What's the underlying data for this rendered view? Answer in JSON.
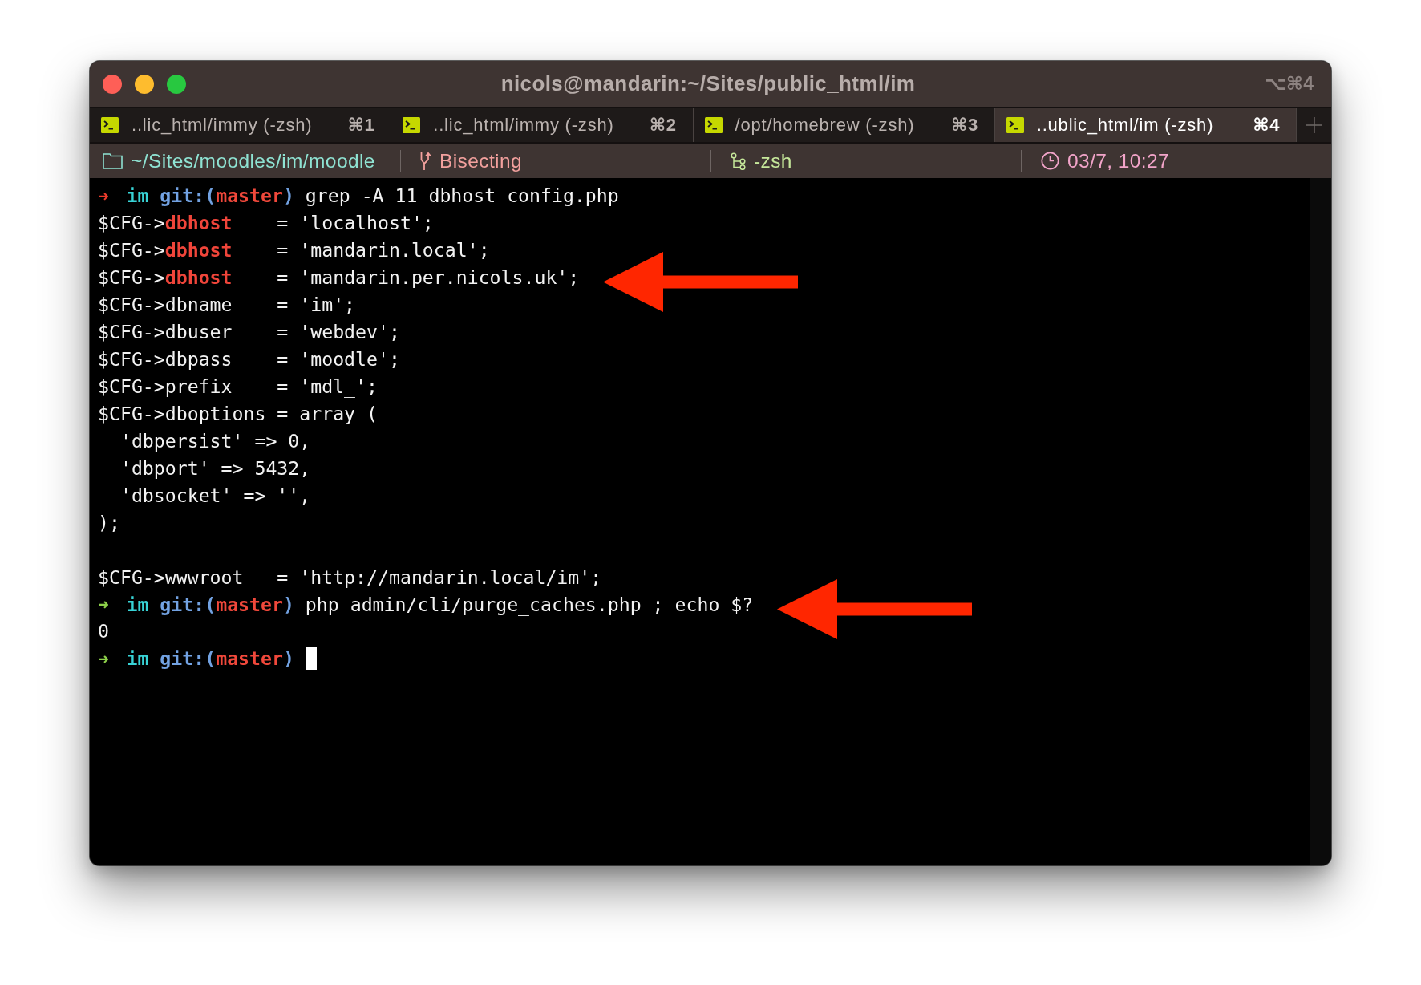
{
  "window": {
    "title": "nicols@mandarin:~/Sites/public_html/im",
    "shortcut": "⌥⌘4"
  },
  "tabs": [
    {
      "title": "..lic_html/immy (-zsh)",
      "shortcut": "⌘1",
      "selected": false
    },
    {
      "title": "..lic_html/immy (-zsh)",
      "shortcut": "⌘2",
      "selected": false
    },
    {
      "title": "/opt/homebrew (-zsh)",
      "shortcut": "⌘3",
      "selected": false
    },
    {
      "title": "..ublic_html/im (-zsh)",
      "shortcut": "⌘4",
      "selected": true
    }
  ],
  "status_bar": [
    {
      "kind": "path",
      "text": "~/Sites/moodles/im/moodle",
      "color": "#8fe3d3"
    },
    {
      "kind": "git",
      "text": "Bisecting",
      "color": "#f3a19e"
    },
    {
      "kind": "job",
      "text": "-zsh",
      "color": "#c6e89b"
    },
    {
      "kind": "clock",
      "text": "03/7, 10:27",
      "color": "#f2a4c9"
    }
  ],
  "terminal": {
    "lines": [
      {
        "kind": "prompt",
        "arrow": "➜",
        "succeeded": false,
        "directory": "im",
        "branch_open": "git:(",
        "branch": "master",
        "branch_close": ")",
        "command": "grep -A 11 dbhost config.php",
        "cursor": false,
        "marked": false
      },
      {
        "kind": "output",
        "text": "$CFG->**dbhost**    = 'localhost';",
        "marked": false
      },
      {
        "kind": "output",
        "text": "$CFG->**dbhost**    = 'mandarin.local';",
        "marked": false
      },
      {
        "kind": "output",
        "text": "$CFG->**dbhost**    = 'mandarin.per.nicols.uk';",
        "marked": true
      },
      {
        "kind": "output",
        "text": "$CFG->dbname    = 'im';",
        "marked": false
      },
      {
        "kind": "output",
        "text": "$CFG->dbuser    = 'webdev';",
        "marked": false
      },
      {
        "kind": "output",
        "text": "$CFG->dbpass    = 'moodle';",
        "marked": false
      },
      {
        "kind": "output",
        "text": "$CFG->prefix    = 'mdl_';",
        "marked": false
      },
      {
        "kind": "output",
        "text": "$CFG->dboptions = array (",
        "marked": false
      },
      {
        "kind": "output",
        "text": "  'dbpersist' => 0,",
        "marked": false
      },
      {
        "kind": "output",
        "text": "  'dbport' => 5432,",
        "marked": false
      },
      {
        "kind": "output",
        "text": "  'dbsocket' => '',",
        "marked": false
      },
      {
        "kind": "output",
        "text": ");",
        "marked": false
      },
      {
        "kind": "blank",
        "marked": false
      },
      {
        "kind": "output",
        "text": "$CFG->wwwroot   = 'http://mandarin.local/im';",
        "marked": false
      },
      {
        "kind": "prompt",
        "arrow": "➜",
        "succeeded": true,
        "directory": "im",
        "branch_open": "git:(",
        "branch": "master",
        "branch_close": ")",
        "command": "php admin/cli/purge_caches.php ; echo $?",
        "cursor": false,
        "marked": true
      },
      {
        "kind": "output",
        "text": "0",
        "marked": false
      },
      {
        "kind": "prompt",
        "arrow": "➜",
        "succeeded": true,
        "directory": "im",
        "branch_open": "git:(",
        "branch": "master",
        "branch_close": ")",
        "cursor": true,
        "marked": false
      }
    ]
  }
}
